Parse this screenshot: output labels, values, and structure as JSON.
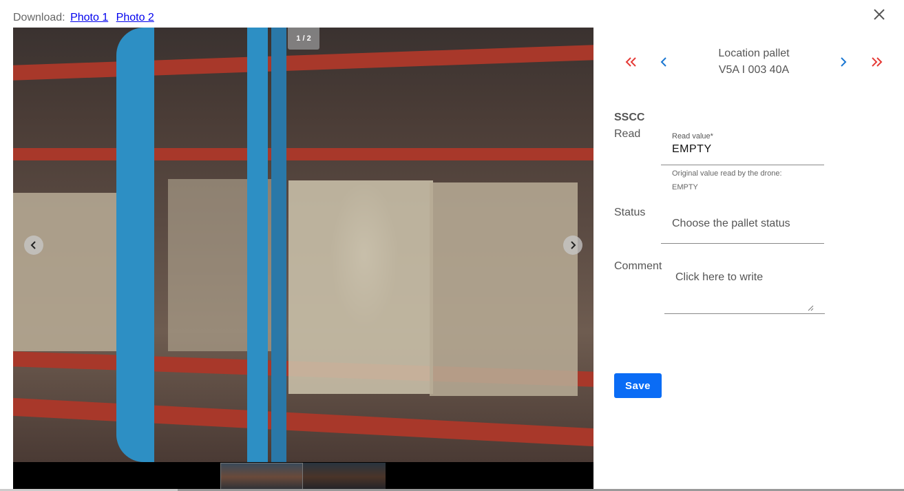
{
  "download": {
    "label": "Download:",
    "links": [
      "Photo 1",
      "Photo 2"
    ]
  },
  "viewer": {
    "counter": "1 / 2"
  },
  "location": {
    "title": "Location pallet",
    "code": "V5A I 003 40A"
  },
  "form": {
    "sscc_label": "SSCC",
    "read_label": "Read",
    "read_field_label": "Read value*",
    "read_value": "EMPTY",
    "helper_line1": "Original value read by the drone:",
    "helper_line2": "EMPTY",
    "status_label": "Status",
    "status_placeholder": "Choose the pallet status",
    "comment_label": "Comment",
    "comment_placeholder": "Click here to write",
    "save_label": "Save"
  },
  "icons": {
    "close": "close-icon",
    "first": "double-chevron-left-icon",
    "prev": "chevron-left-icon",
    "next": "chevron-right-icon",
    "last": "double-chevron-right-icon"
  },
  "colors": {
    "accent_blue": "#0a6cf5",
    "nav_red": "#e53935",
    "nav_blue": "#1976d2"
  }
}
